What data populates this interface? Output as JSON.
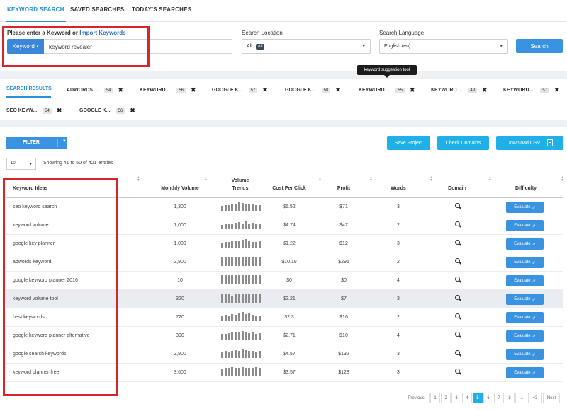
{
  "top_tabs": [
    "KEYWORD SEARCH",
    "SAVED SEARCHES",
    "TODAY'S SEARCHES"
  ],
  "search": {
    "prompt": "Please enter a Keyword or",
    "import_link": "Import Keywords",
    "type_button": "Keyword",
    "keyword_value": "keyword revealer",
    "location_label": "Search Location",
    "location_value": "All",
    "location_pill": "All",
    "language_label": "Search Language",
    "language_value": "English (en)",
    "search_button": "Search"
  },
  "tooltip": "keyword suggestion tool",
  "result_tabs": [
    {
      "label": "SEARCH RESULTS",
      "badge": "",
      "active": true
    },
    {
      "label": "ADWORDS ...",
      "badge": "54"
    },
    {
      "label": "KEYWORD ...",
      "badge": "56"
    },
    {
      "label": "GOOGLE K...",
      "badge": "57"
    },
    {
      "label": "GOOGLE K...",
      "badge": "58"
    },
    {
      "label": "KEYWORD ...",
      "badge": "55"
    },
    {
      "label": "KEYWORD ...",
      "badge": "49"
    },
    {
      "label": "KEYWORD ...",
      "badge": "57"
    },
    {
      "label": "SEO KEYW...",
      "badge": "54"
    },
    {
      "label": "GOOGLE K...",
      "badge": "56"
    }
  ],
  "toolbar": {
    "filter": "FILTER",
    "save_project": "Save Project",
    "check_domains": "Check Domains",
    "download_csv": "Download CSV",
    "page_size": "10",
    "entries_info": "Showing 41 to 50 of 421 entries"
  },
  "columns": {
    "ideas": "Keyword Ideas",
    "volume": "Monthly Volume",
    "trends_1": "Volume",
    "trends_2": "Trends",
    "cpc": "Cost Per Click",
    "profit": "Profit",
    "words": "Words",
    "domain": "Domain",
    "difficulty": "Difficulty"
  },
  "evaluate_label": "Evaluate",
  "rows": [
    {
      "keyword": "seo keyword search",
      "volume": "1,300",
      "cpc": "$5.52",
      "profit": "$71",
      "words": "3",
      "trend": [
        0.55,
        0.6,
        0.65,
        0.7,
        0.75,
        0.9,
        0.85,
        0.8,
        0.75,
        0.7,
        0.65,
        0.6
      ]
    },
    {
      "keyword": "keyword volume",
      "volume": "1,000",
      "cpc": "$4.74",
      "profit": "$47",
      "words": "2",
      "trend": [
        0.5,
        0.55,
        0.6,
        0.65,
        0.7,
        0.8,
        0.65,
        0.95,
        0.6,
        0.7,
        0.55,
        0.6
      ]
    },
    {
      "keyword": "google key planner",
      "volume": "1,000",
      "cpc": "$1.22",
      "profit": "$12",
      "words": "3",
      "trend": [
        0.55,
        0.6,
        0.6,
        0.7,
        0.75,
        0.8,
        0.85,
        0.9,
        0.75,
        0.65,
        0.6,
        0.7
      ]
    },
    {
      "keyword": "adwords keyword",
      "volume": "2,900",
      "cpc": "$10.19",
      "profit": "$295",
      "words": "2",
      "trend": [
        1,
        1,
        0.95,
        1,
        0.95,
        1,
        1,
        0.95,
        1,
        0.95,
        0.95,
        1
      ]
    },
    {
      "keyword": "google keyword planner 2016",
      "volume": "10",
      "cpc": "$0",
      "profit": "$0",
      "words": "4",
      "trend": [
        1,
        1,
        1,
        1,
        1,
        1,
        1,
        1,
        1,
        1,
        1,
        1
      ]
    },
    {
      "keyword": "keyword volume tool",
      "volume": "320",
      "cpc": "$2.21",
      "profit": "$7",
      "words": "3",
      "trend": [
        0.95,
        0.9,
        0.9,
        0.8,
        0.9,
        0.95,
        0.9,
        0.95,
        0.9,
        0.9,
        0.95,
        0.9
      ],
      "highlight": true
    },
    {
      "keyword": "best keywords",
      "volume": "720",
      "cpc": "$2.3",
      "profit": "$16",
      "words": "2",
      "trend": [
        0.55,
        0.7,
        0.65,
        0.8,
        0.7,
        0.9,
        1,
        0.75,
        0.85,
        0.7,
        0.6,
        0.65
      ]
    },
    {
      "keyword": "google keyword planner alternative",
      "volume": "390",
      "cpc": "$2.71",
      "profit": "$10",
      "words": "4",
      "trend": [
        0.6,
        0.65,
        0.7,
        0.8,
        0.75,
        0.85,
        0.9,
        0.8,
        0.7,
        0.75,
        0.65,
        0.7
      ]
    },
    {
      "keyword": "google search keywords",
      "volume": "2,900",
      "cpc": "$4.57",
      "profit": "$132",
      "words": "3",
      "trend": [
        0.6,
        0.75,
        0.7,
        0.8,
        0.85,
        0.75,
        0.9,
        0.85,
        0.8,
        0.75,
        0.7,
        0.8
      ]
    },
    {
      "keyword": "keyword planner free",
      "volume": "3,600",
      "cpc": "$3.57",
      "profit": "$128",
      "words": "3",
      "trend": [
        0.85,
        0.9,
        0.95,
        1,
        0.95,
        0.9,
        1,
        0.95,
        0.9,
        0.95,
        1,
        0.9
      ]
    }
  ],
  "pagination": [
    "Previous",
    "1",
    "2",
    "3",
    "4",
    "5",
    "6",
    "7",
    "8",
    "...",
    "43",
    "Next"
  ],
  "pagination_current": "5",
  "colors": {
    "accent": "#2a8fd6",
    "button": "#3a93e0",
    "cyan": "#20b0e8",
    "annotation": "#d8252d"
  }
}
